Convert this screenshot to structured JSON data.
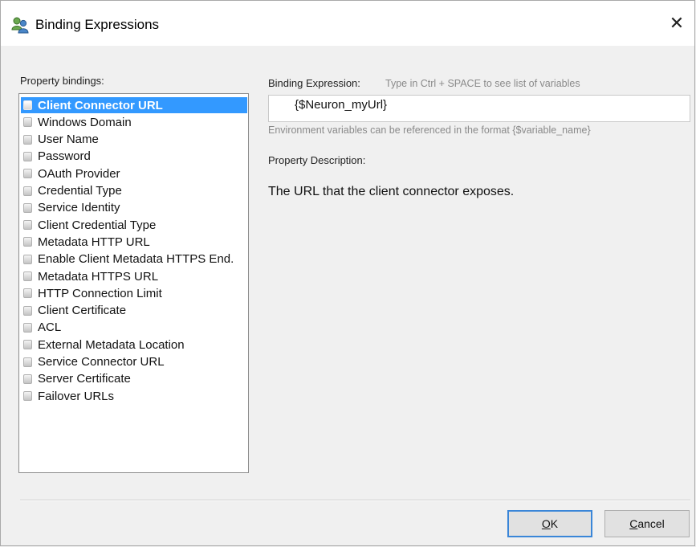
{
  "window": {
    "title": "Binding Expressions",
    "app_icon": "users-icon",
    "close_glyph": "✕"
  },
  "left": {
    "label": "Property bindings:",
    "items": [
      {
        "label": "Client Connector URL",
        "selected": true
      },
      {
        "label": "Windows Domain"
      },
      {
        "label": "User Name"
      },
      {
        "label": "Password"
      },
      {
        "label": "OAuth Provider"
      },
      {
        "label": "Credential Type"
      },
      {
        "label": "Service Identity"
      },
      {
        "label": "Client Credential Type"
      },
      {
        "label": "Metadata HTTP URL"
      },
      {
        "label": "Enable Client Metadata HTTPS End."
      },
      {
        "label": "Metadata HTTPS URL"
      },
      {
        "label": "HTTP Connection Limit"
      },
      {
        "label": "Client Certificate"
      },
      {
        "label": "ACL"
      },
      {
        "label": "External Metadata Location"
      },
      {
        "label": "Service Connector URL"
      },
      {
        "label": "Server Certificate"
      },
      {
        "label": "Failover URLs"
      }
    ]
  },
  "right": {
    "binding_label": "Binding Expression:",
    "binding_hint": "Type in Ctrl + SPACE to see list of variables",
    "expression_value": "{$Neuron_myUrl}",
    "env_hint": "Environment variables can be referenced in the format {$variable_name}",
    "description_label": "Property Description:",
    "description_text": "The URL that the client connector exposes."
  },
  "buttons": {
    "ok_label": "OK",
    "ok_mnemonic": "O",
    "ok_rest": "K",
    "cancel_label": "Cancel",
    "cancel_mnemonic": "C",
    "cancel_rest": "ancel"
  },
  "colors": {
    "selection": "#3399ff",
    "default_button_border": "#3a86d8"
  }
}
